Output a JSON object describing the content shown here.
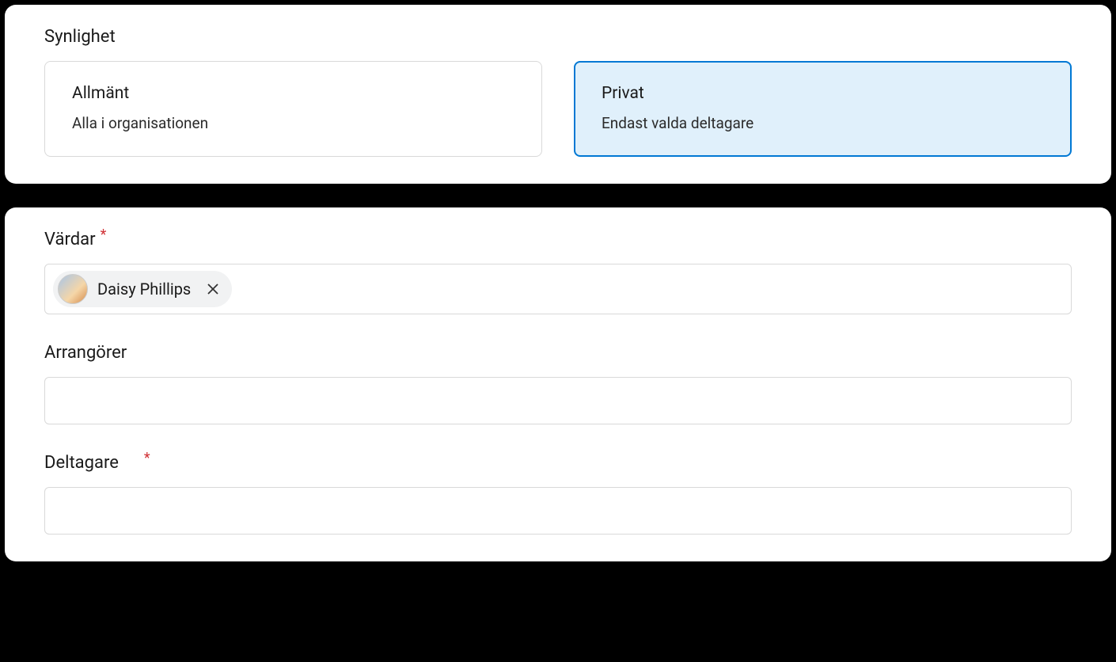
{
  "visibility": {
    "title": "Synlighet",
    "options": [
      {
        "title": "Allmänt",
        "description": "Alla i organisationen",
        "selected": false
      },
      {
        "title": "Privat",
        "description": "Endast valda deltagare",
        "selected": true
      }
    ]
  },
  "fields": {
    "hosts": {
      "label": "Värdar",
      "required": true,
      "chips": [
        {
          "name": "Daisy Phillips"
        }
      ]
    },
    "organizers": {
      "label": "Arrangörer",
      "required": false
    },
    "participants": {
      "label": "Deltagare",
      "required": true
    }
  }
}
